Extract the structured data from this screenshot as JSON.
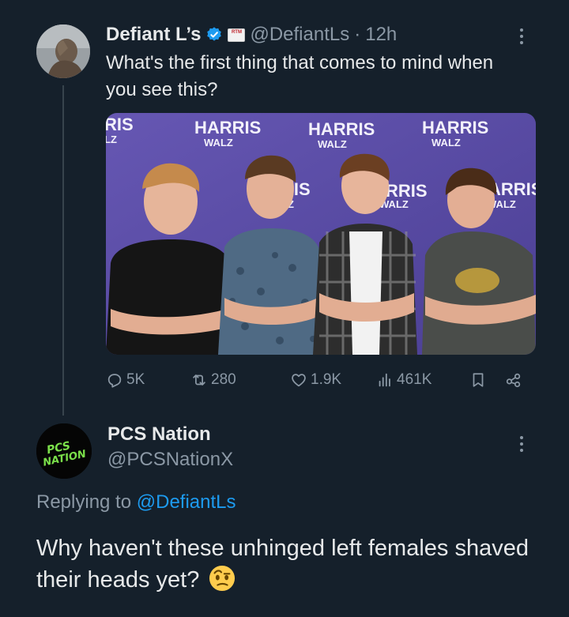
{
  "tweet": {
    "author_name": "Defiant L’s",
    "affiliate_badge_text": "RTM",
    "handle": "@DefiantLs",
    "separator": "·",
    "time": "12h",
    "text": "What's the first thing that comes to mind when you see this?",
    "media": {
      "backdrop_main": "HARRIS",
      "backdrop_sub": "WALZ",
      "backdrop_partial_main": "RIS",
      "backdrop_partial_sub": "LZ",
      "backdrop_partial2_main": "RRIS",
      "backdrop_partial2_sub": "WALZ",
      "backdrop_partial3_main": "ARRIS",
      "backdrop_partial3_sub": "WALZ",
      "backdrop_color": "#5b4fa6"
    },
    "stats": {
      "replies": "5K",
      "reposts": "280",
      "likes": "1.9K",
      "views": "461K"
    }
  },
  "reply": {
    "author_name": "PCS Nation",
    "avatar_text": "PCS NATION",
    "handle": "@PCSNationX",
    "replying_prefix": "Replying to",
    "replying_handle": "@DefiantLs",
    "text": "Why haven't these unhinged left females shaved their heads yet?",
    "emoji": "raised-eyebrow-emoji"
  },
  "colors": {
    "background": "#15202b",
    "primary_text": "#e7e9ea",
    "secondary_text": "#8b98a5",
    "accent": "#1d9bf0"
  }
}
